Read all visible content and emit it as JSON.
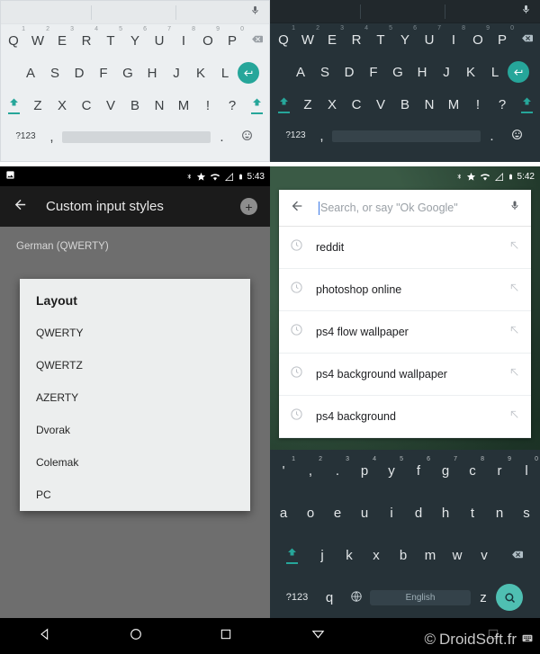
{
  "panels": {
    "keyboard_light": {
      "name": "Material light QWERTY keyboard",
      "suggestion_mic": "mic-icon",
      "row1": [
        {
          "k": "Q",
          "n": "1"
        },
        {
          "k": "W",
          "n": "2"
        },
        {
          "k": "E",
          "n": "3"
        },
        {
          "k": "R",
          "n": "4"
        },
        {
          "k": "T",
          "n": "5"
        },
        {
          "k": "Y",
          "n": "6"
        },
        {
          "k": "U",
          "n": "7"
        },
        {
          "k": "I",
          "n": "8"
        },
        {
          "k": "O",
          "n": "9"
        },
        {
          "k": "P",
          "n": "0"
        }
      ],
      "row1_end": "backspace",
      "row2": [
        "A",
        "S",
        "D",
        "F",
        "G",
        "H",
        "J",
        "K",
        "L"
      ],
      "row2_end": "enter",
      "row3_shift": "shift",
      "row3": [
        "Z",
        "X",
        "C",
        "V",
        "B",
        "N",
        "M",
        "!",
        "?"
      ],
      "row3_end": "shift",
      "row4": {
        "symbols": "?123",
        "comma": ",",
        "space": "",
        "period": ".",
        "emoji": "emoji-icon"
      }
    },
    "keyboard_dark": {
      "name": "Material dark QWERTY keyboard",
      "suggestion_mic": "mic-icon",
      "row1": [
        {
          "k": "Q",
          "n": "1"
        },
        {
          "k": "W",
          "n": "2"
        },
        {
          "k": "E",
          "n": "3"
        },
        {
          "k": "R",
          "n": "4"
        },
        {
          "k": "T",
          "n": "5"
        },
        {
          "k": "Y",
          "n": "6"
        },
        {
          "k": "U",
          "n": "7"
        },
        {
          "k": "I",
          "n": "8"
        },
        {
          "k": "O",
          "n": "9"
        },
        {
          "k": "P",
          "n": "0"
        }
      ],
      "row2": [
        "A",
        "S",
        "D",
        "F",
        "G",
        "H",
        "J",
        "K",
        "L"
      ],
      "row3": [
        "Z",
        "X",
        "C",
        "V",
        "B",
        "N",
        "M",
        "!",
        "?"
      ],
      "row4": {
        "symbols": "?123",
        "comma": ",",
        "space": "",
        "period": ".",
        "emoji": "emoji-icon"
      }
    },
    "settings": {
      "statusbar": {
        "time": "5:43",
        "icons": [
          "screenshot-icon",
          "bluetooth-icon",
          "star-icon",
          "wifi-icon",
          "signal-icon",
          "battery-icon"
        ]
      },
      "appbar": {
        "back": "back-arrow-icon",
        "title": "Custom input styles",
        "add": "+"
      },
      "list_item": "German (QWERTY)",
      "dialog": {
        "title": "Layout",
        "options": [
          "QWERTY",
          "QWERTZ",
          "AZERTY",
          "Dvorak",
          "Colemak",
          "PC"
        ]
      },
      "navbar": [
        "back-triangle-icon",
        "home-circle-icon",
        "recents-square-icon"
      ]
    },
    "search": {
      "statusbar": {
        "time": "5:42",
        "icons": [
          "bluetooth-icon",
          "star-icon",
          "wifi-icon",
          "signal-icon",
          "battery-icon"
        ]
      },
      "searchbar": {
        "back": "back-arrow-icon",
        "placeholder": "Search, or say \"Ok Google\"",
        "value": "",
        "mic": "mic-icon"
      },
      "suggestions": [
        {
          "icon": "history-clock-icon",
          "text": "reddit",
          "action": "arrow-up-left-icon"
        },
        {
          "icon": "history-clock-icon",
          "text": "photoshop online",
          "action": "arrow-up-left-icon"
        },
        {
          "icon": "history-clock-icon",
          "text": "ps4 flow wallpaper",
          "action": "arrow-up-left-icon"
        },
        {
          "icon": "history-clock-icon",
          "text": "ps4 background wallpaper",
          "action": "arrow-up-left-icon"
        },
        {
          "icon": "history-clock-icon",
          "text": "ps4 background",
          "action": "arrow-up-left-icon"
        }
      ],
      "keyboard_dvorak": {
        "name": "Dvorak dark keyboard",
        "row1": [
          {
            "k": "'",
            "n": "1"
          },
          {
            "k": ",",
            "n": "2"
          },
          {
            "k": ".",
            "n": "3"
          },
          {
            "k": "p",
            "n": "4"
          },
          {
            "k": "y",
            "n": "5"
          },
          {
            "k": "f",
            "n": "6"
          },
          {
            "k": "g",
            "n": "7"
          },
          {
            "k": "c",
            "n": "8"
          },
          {
            "k": "r",
            "n": "9"
          },
          {
            "k": "l",
            "n": "0"
          }
        ],
        "row2": [
          "a",
          "o",
          "e",
          "u",
          "i",
          "d",
          "h",
          "t",
          "n",
          "s"
        ],
        "row3_shift": "shift",
        "row3": [
          "j",
          "k",
          "x",
          "b",
          "m",
          "w",
          "v"
        ],
        "row3_end": "backspace",
        "row4": {
          "symbols": "?123",
          "q": "q",
          "globe": "globe-icon",
          "language": "English",
          "z": "z",
          "search": "search-icon"
        }
      },
      "navbar": [
        "back-triangle-icon",
        "home-circle-icon",
        "recents-square-icon"
      ]
    }
  },
  "watermark": {
    "mark": "©",
    "text": "DroidSoft.fr"
  },
  "colors": {
    "accent_teal": "#26a69a",
    "accent_teal_light": "#4fbfb2",
    "kb_dark_bg": "#263238",
    "kb_light_bg": "#eceff1",
    "cursor_blue": "#3b78e7"
  }
}
